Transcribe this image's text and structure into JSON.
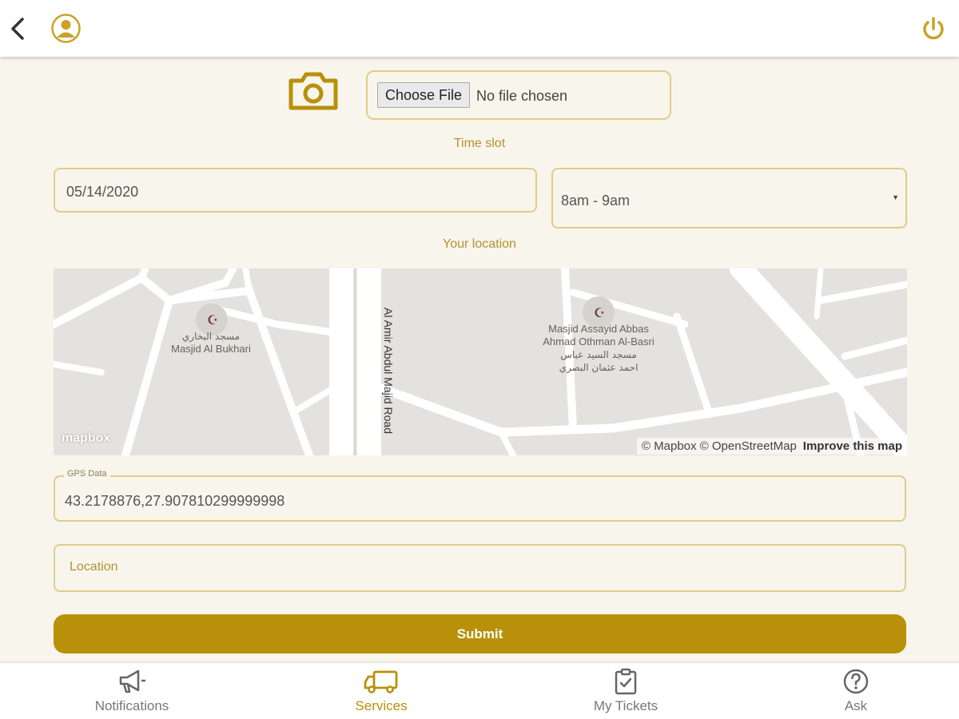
{
  "header": {
    "back_icon": "chevron-left-icon",
    "avatar_icon": "user-avatar-icon",
    "power_icon": "power-icon"
  },
  "photo": {
    "camera_icon": "camera-icon",
    "choose_file_label": "Choose File",
    "file_status": "No file chosen"
  },
  "time_slot": {
    "label": "Time slot",
    "date_value": "05/14/2020",
    "slot_value": "8am - 9am"
  },
  "location": {
    "label": "Your location",
    "map": {
      "road_label": "Al Amir Abdul Majid Road",
      "poi_1": {
        "arabic": "مسجد البخاري",
        "name": "Masjid Al Bukhari"
      },
      "poi_2": {
        "name_line1": "Masjid Assayid Abbas",
        "name_line2": "Ahmad Othman Al-Basri",
        "arabic_line1": "مسجد السيد عباس",
        "arabic_line2": "احمد عثمان البصري"
      },
      "logo": "mapbox",
      "attribution": "© Mapbox © OpenStreetMap",
      "improve_link": "Improve this map"
    },
    "gps_label": "GPS Data",
    "gps_value": "43.2178876,27.907810299999998",
    "location_placeholder": "Location"
  },
  "submit_label": "Submit",
  "bottom_nav": {
    "items": [
      {
        "label": "Notifications",
        "icon": "megaphone-icon"
      },
      {
        "label": "Services",
        "icon": "truck-icon",
        "active": true
      },
      {
        "label": "My Tickets",
        "icon": "clipboard-check-icon"
      },
      {
        "label": "Ask",
        "icon": "question-circle-icon"
      }
    ]
  },
  "colors": {
    "accent": "#b8900a",
    "border": "#e0cc8a",
    "background": "#f8f5ec"
  }
}
